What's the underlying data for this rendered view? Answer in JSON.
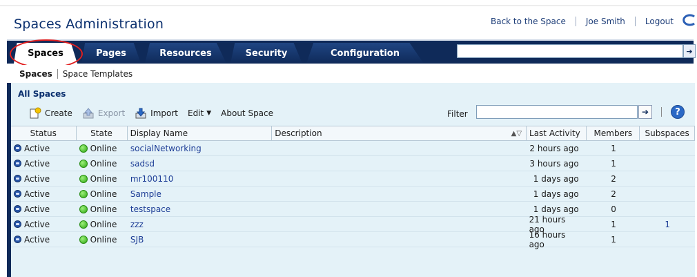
{
  "header": {
    "title": "Spaces Administration",
    "links": [
      "Back to the Space",
      "Joe Smith",
      "Logout"
    ]
  },
  "tabs": [
    {
      "label": "Spaces",
      "active": true
    },
    {
      "label": "Pages",
      "active": false
    },
    {
      "label": "Resources",
      "active": false
    },
    {
      "label": "Security",
      "active": false
    },
    {
      "label": "Configuration",
      "active": false
    }
  ],
  "subtabs": [
    {
      "label": "Spaces",
      "active": true
    },
    {
      "label": "Space Templates",
      "active": false
    }
  ],
  "panel": {
    "title": "All Spaces",
    "toolbar": {
      "create": "Create",
      "export": "Export",
      "import": "Import",
      "edit": "Edit",
      "about": "About Space"
    },
    "filter_label": "Filter",
    "help_glyph": "?"
  },
  "table": {
    "columns": [
      "Status",
      "State",
      "Display Name",
      "Description",
      "Last Activity",
      "Members",
      "Subspaces"
    ],
    "rows": [
      {
        "status": "Active",
        "state": "Online",
        "name": "socialNetworking",
        "description": "",
        "last_activity": "2 hours ago",
        "members": "1",
        "subspaces": ""
      },
      {
        "status": "Active",
        "state": "Online",
        "name": "sadsd",
        "description": "",
        "last_activity": "3 hours ago",
        "members": "1",
        "subspaces": ""
      },
      {
        "status": "Active",
        "state": "Online",
        "name": "mr100110",
        "description": "",
        "last_activity": "1 days ago",
        "members": "2",
        "subspaces": ""
      },
      {
        "status": "Active",
        "state": "Online",
        "name": "Sample",
        "description": "",
        "last_activity": "1 days ago",
        "members": "2",
        "subspaces": ""
      },
      {
        "status": "Active",
        "state": "Online",
        "name": "testspace",
        "description": "",
        "last_activity": "1 days ago",
        "members": "0",
        "subspaces": ""
      },
      {
        "status": "Active",
        "state": "Online",
        "name": "zzz",
        "description": "",
        "last_activity": "21 hours ago",
        "members": "1",
        "subspaces": "1"
      },
      {
        "status": "Active",
        "state": "Online",
        "name": "SJB",
        "description": "",
        "last_activity": "16 hours ago",
        "members": "1",
        "subspaces": ""
      }
    ]
  },
  "colors": {
    "brand_navy": "#0f2a59",
    "panel_bg": "#e4f2f8",
    "highlight_circle": "#e22020"
  }
}
